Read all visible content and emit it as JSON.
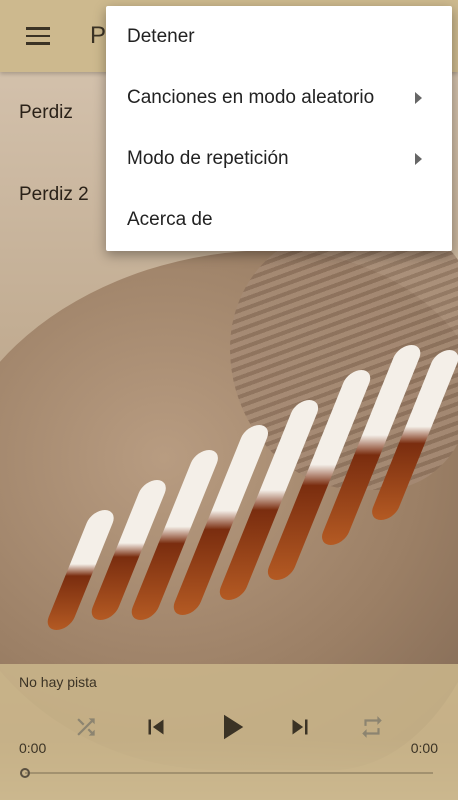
{
  "app_bar": {
    "title": "P",
    "menu_icon": "hamburger-menu-icon"
  },
  "tracks": [
    {
      "label": "Perdiz"
    },
    {
      "label": "Perdiz 2"
    }
  ],
  "overflow_menu": {
    "items": [
      {
        "label": "Detener",
        "has_submenu": false
      },
      {
        "label": "Canciones en modo aleatorio",
        "has_submenu": true
      },
      {
        "label": "Modo de repetición",
        "has_submenu": true
      },
      {
        "label": "Acerca de",
        "has_submenu": false
      }
    ]
  },
  "player": {
    "now_playing": "No hay pista",
    "elapsed": "0:00",
    "duration": "0:00",
    "progress": 0,
    "controls": {
      "shuffle_icon": "shuffle-icon",
      "previous_icon": "skip-previous-icon",
      "play_icon": "play-icon",
      "next_icon": "skip-next-icon",
      "repeat_icon": "repeat-icon"
    },
    "colors": {
      "icon_active": "#3b3325",
      "icon_disabled": "#8c8470"
    }
  },
  "colors": {
    "app_bar": "#cdb98e",
    "menu_background": "#ffffff"
  }
}
